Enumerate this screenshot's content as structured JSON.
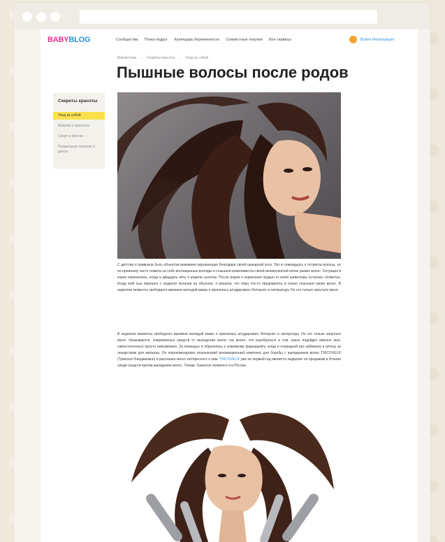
{
  "site": {
    "logo_part1": "BABY",
    "logo_part2": "BLOG"
  },
  "nav": {
    "items": [
      "Сообщества",
      "Поиск подруг",
      "Календарь беременности",
      "Совместные покупки",
      "Все сервисы"
    ],
    "login_label": "Войти Регистрация"
  },
  "breadcrumb": {
    "items": [
      "Библиотека",
      "Секреты красоты",
      "Уход за собой"
    ],
    "separator": "→"
  },
  "page_title": "Пышные волосы после родов",
  "sidebar": {
    "title": "Секреты красоты",
    "items": [
      {
        "label": "Уход за собой",
        "active": true
      },
      {
        "label": "Макияж и прическа",
        "active": false
      },
      {
        "label": "Спорт и фитнес",
        "active": false
      },
      {
        "label": "Правильное питание и диеты",
        "active": false
      }
    ]
  },
  "article": {
    "p1": "С детства я привыкла быть объектом внимания окружающих благодаря своей шикарной косе. Лет в семнадцать я остригла волосы, но по-прежнему часто ловила на себе восхищенные взгляды и слышала комплименты своей великолепной копне рыжих волос. Ситуация в корне изменилась, когда в двадцать пять я родила сыночку. После родов и кормления грудью от моей шевелюры остались лохмотья. Когда мой сын перешел с грудного питания на обычное, я решила, что пора что-то предпринять в плане спасения своих волос. В недолгие моменты свободного времени молодой мамы я принялась штудировать Интернет и литературу. Но это только запутало меня.",
    "p2": "В недолгие моменты свободного времени молодой мамы я принялась штудировать Интернет и литературу. Но это только запутало меня. Оказывается, современных средств от выпадения волос так много, что разобраться в том, какое подойдет именно мне, самостоятельно просто невозможно. За помощью я обратилась к знакомому фармацевту, когда в очередной раз забежала в аптеку за лекарством для малыша. Он порекомендовал итальянский инновационный комплекс для борьбы с выпадением волос TRICOVEL® (Трикохэл Биоджинкно) и рассказал много интересного о нем.",
    "link": "TRICOVEL®",
    "p3": "уже не первый год является лидером¹ по продажам в Италии среди средств против выпадения волос. Теперь Трикохэл появился и в России."
  },
  "colors": {
    "accent_yellow": "#fbe04b",
    "logo_pink": "#e8328f",
    "logo_blue": "#2b8fd6",
    "login_orange": "#f3a431"
  }
}
